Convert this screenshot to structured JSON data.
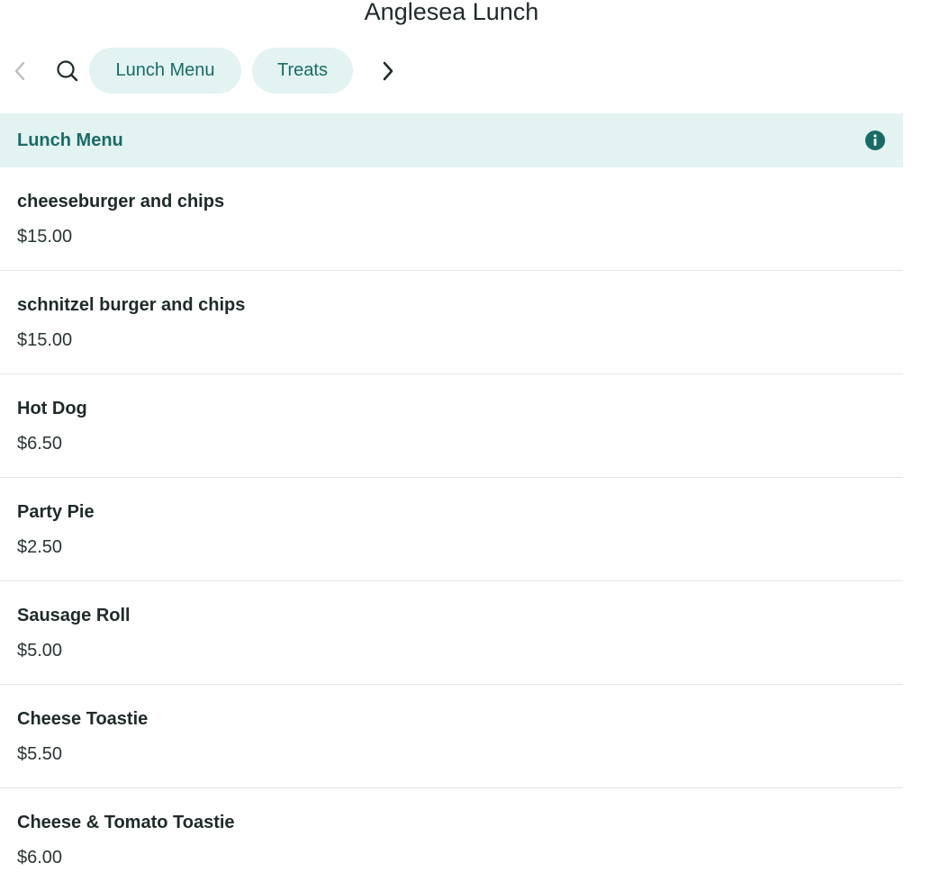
{
  "header": {
    "title": "Anglesea Lunch"
  },
  "category_nav": {
    "prev_icon": "chevron-left-icon",
    "search_icon": "search-icon",
    "next_icon": "chevron-right-icon",
    "categories": [
      {
        "label": "Lunch Menu"
      },
      {
        "label": "Treats"
      }
    ]
  },
  "section": {
    "title": "Lunch Menu",
    "info_icon": "info-icon"
  },
  "items": [
    {
      "name": "cheeseburger and chips",
      "price": "$15.00"
    },
    {
      "name": "schnitzel burger and chips",
      "price": "$15.00"
    },
    {
      "name": "Hot Dog",
      "price": "$6.50"
    },
    {
      "name": "Party Pie",
      "price": "$2.50"
    },
    {
      "name": "Sausage Roll",
      "price": "$5.00"
    },
    {
      "name": "Cheese Toastie",
      "price": "$5.50"
    },
    {
      "name": "Cheese & Tomato Toastie",
      "price": "$6.00"
    }
  ],
  "colors": {
    "accent": "#1a6b66",
    "pill_bg": "#e2f3f2",
    "header_bg": "#e3f3f2",
    "divider": "#e3e6e6"
  }
}
